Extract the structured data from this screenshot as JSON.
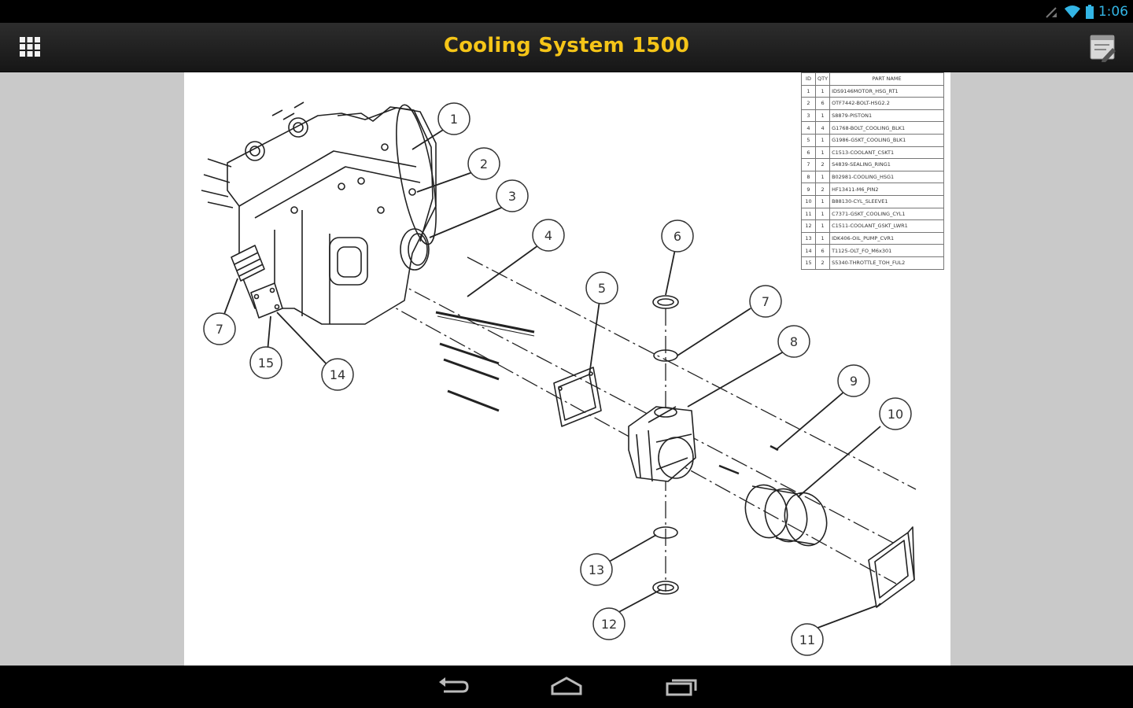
{
  "status_bar": {
    "time": "1:06",
    "icons": [
      "signal-off-icon",
      "wifi-icon",
      "battery-icon"
    ]
  },
  "action_bar": {
    "title": "Cooling System 1500",
    "title_color": "#f5c518",
    "left_icon": "grid-menu-icon",
    "right_icon": "edit-notes-icon"
  },
  "parts_table": {
    "headers": [
      "ID",
      "QTY",
      "PART NAME"
    ],
    "rows": [
      {
        "id": "1",
        "qty": "1",
        "name": "IDS9146MOTOR_HSG_RT1"
      },
      {
        "id": "2",
        "qty": "6",
        "name": "OTF7442-BOLT-HSG2.2"
      },
      {
        "id": "3",
        "qty": "1",
        "name": "S8879-PISTON1"
      },
      {
        "id": "4",
        "qty": "4",
        "name": "G1768-BOLT_COOLING_BLK1"
      },
      {
        "id": "5",
        "qty": "1",
        "name": "G1986-GSKT_COOLING_BLK1"
      },
      {
        "id": "6",
        "qty": "1",
        "name": "C1513-COOLANT_CSKT1"
      },
      {
        "id": "7",
        "qty": "2",
        "name": "S4839-SEALING_RING1"
      },
      {
        "id": "8",
        "qty": "1",
        "name": "B02981-COOLING_HSG1"
      },
      {
        "id": "9",
        "qty": "2",
        "name": "HF13411-M6_PIN2"
      },
      {
        "id": "10",
        "qty": "1",
        "name": "B88130-CYL_SLEEVE1"
      },
      {
        "id": "11",
        "qty": "1",
        "name": "C7371-GSKT_COOLING_CYL1"
      },
      {
        "id": "12",
        "qty": "1",
        "name": "C1511-COOLANT_GSKT_LWR1"
      },
      {
        "id": "13",
        "qty": "1",
        "name": "IDK406-OIL_PUMP_CVR1"
      },
      {
        "id": "14",
        "qty": "6",
        "name": "T1125-OLT_FO_M6x301"
      },
      {
        "id": "15",
        "qty": "2",
        "name": "S5340-THROTTLE_TOH_FUL2"
      }
    ]
  },
  "callouts": [
    "1",
    "2",
    "3",
    "4",
    "5",
    "6",
    "7",
    "8",
    "9",
    "10",
    "11",
    "12",
    "13",
    "14",
    "15",
    "7"
  ],
  "nav_bar": {
    "icons": [
      "back-icon",
      "home-icon",
      "recent-apps-icon"
    ]
  }
}
